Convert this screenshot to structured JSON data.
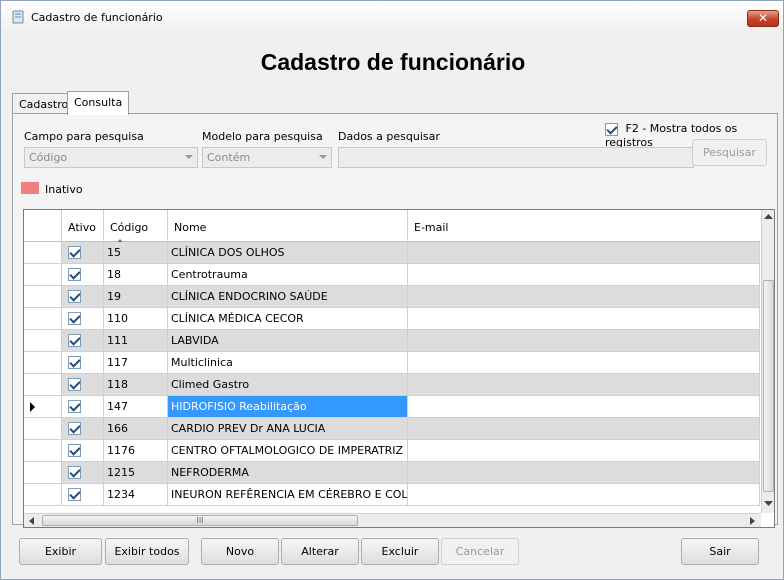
{
  "window": {
    "title": "Cadastro de funcionário",
    "close_label": "✕"
  },
  "heading": "Cadastro de funcionário",
  "tabs": [
    {
      "label": "Cadastro",
      "active": false
    },
    {
      "label": "Consulta",
      "active": true
    }
  ],
  "search": {
    "field_label": "Campo para pesquisa",
    "field_value": "Código",
    "model_label": "Modelo para pesquisa",
    "model_value": "Contém",
    "data_label": "Dados a pesquisar",
    "data_value": "",
    "show_all_label": "F2 - Mostra todos os registros",
    "show_all_checked": true,
    "search_button": "Pesquisar"
  },
  "legend": {
    "inactive_label": "Inativo",
    "inactive_color": "#f08080"
  },
  "grid": {
    "columns": [
      "Ativo",
      "Código",
      "Nome",
      "E-mail"
    ],
    "sorted_column": "Código",
    "rows": [
      {
        "ativo": true,
        "codigo": "15",
        "nome": "CLÍNICA DOS OLHOS"
      },
      {
        "ativo": true,
        "codigo": "18",
        "nome": "Centrotrauma"
      },
      {
        "ativo": true,
        "codigo": "19",
        "nome": "CLÍNICA ENDOCRINO SAÚDE"
      },
      {
        "ativo": true,
        "codigo": "110",
        "nome": "CLÍNICA MÉDICA CECOR"
      },
      {
        "ativo": true,
        "codigo": "111",
        "nome": "LABVIDA"
      },
      {
        "ativo": true,
        "codigo": "117",
        "nome": "Multiclinica"
      },
      {
        "ativo": true,
        "codigo": "118",
        "nome": "Climed Gastro"
      },
      {
        "ativo": true,
        "codigo": "147",
        "nome": "HIDROFISIO Reabilitação",
        "selected": true
      },
      {
        "ativo": true,
        "codigo": "166",
        "nome": "CARDIO PREV Dr ANA LUCIA"
      },
      {
        "ativo": true,
        "codigo": "1176",
        "nome": "CENTRO OFTALMOLOGICO DE IMPERATRIZ"
      },
      {
        "ativo": true,
        "codigo": "1215",
        "nome": "NEFRODERMA"
      },
      {
        "ativo": true,
        "codigo": "1234",
        "nome": "INEURON REFÊRENCIA EM CÉREBRO E COLUNA"
      }
    ],
    "hscroll_grip": "III"
  },
  "buttons": {
    "exibir": "Exibir",
    "exibir_todos": "Exibir todos",
    "novo": "Novo",
    "alterar": "Alterar",
    "excluir": "Excluir",
    "cancelar": "Cancelar",
    "sair": "Sair"
  },
  "colors": {
    "selection": "#3399ff",
    "alt_row": "#dcdcdc"
  }
}
